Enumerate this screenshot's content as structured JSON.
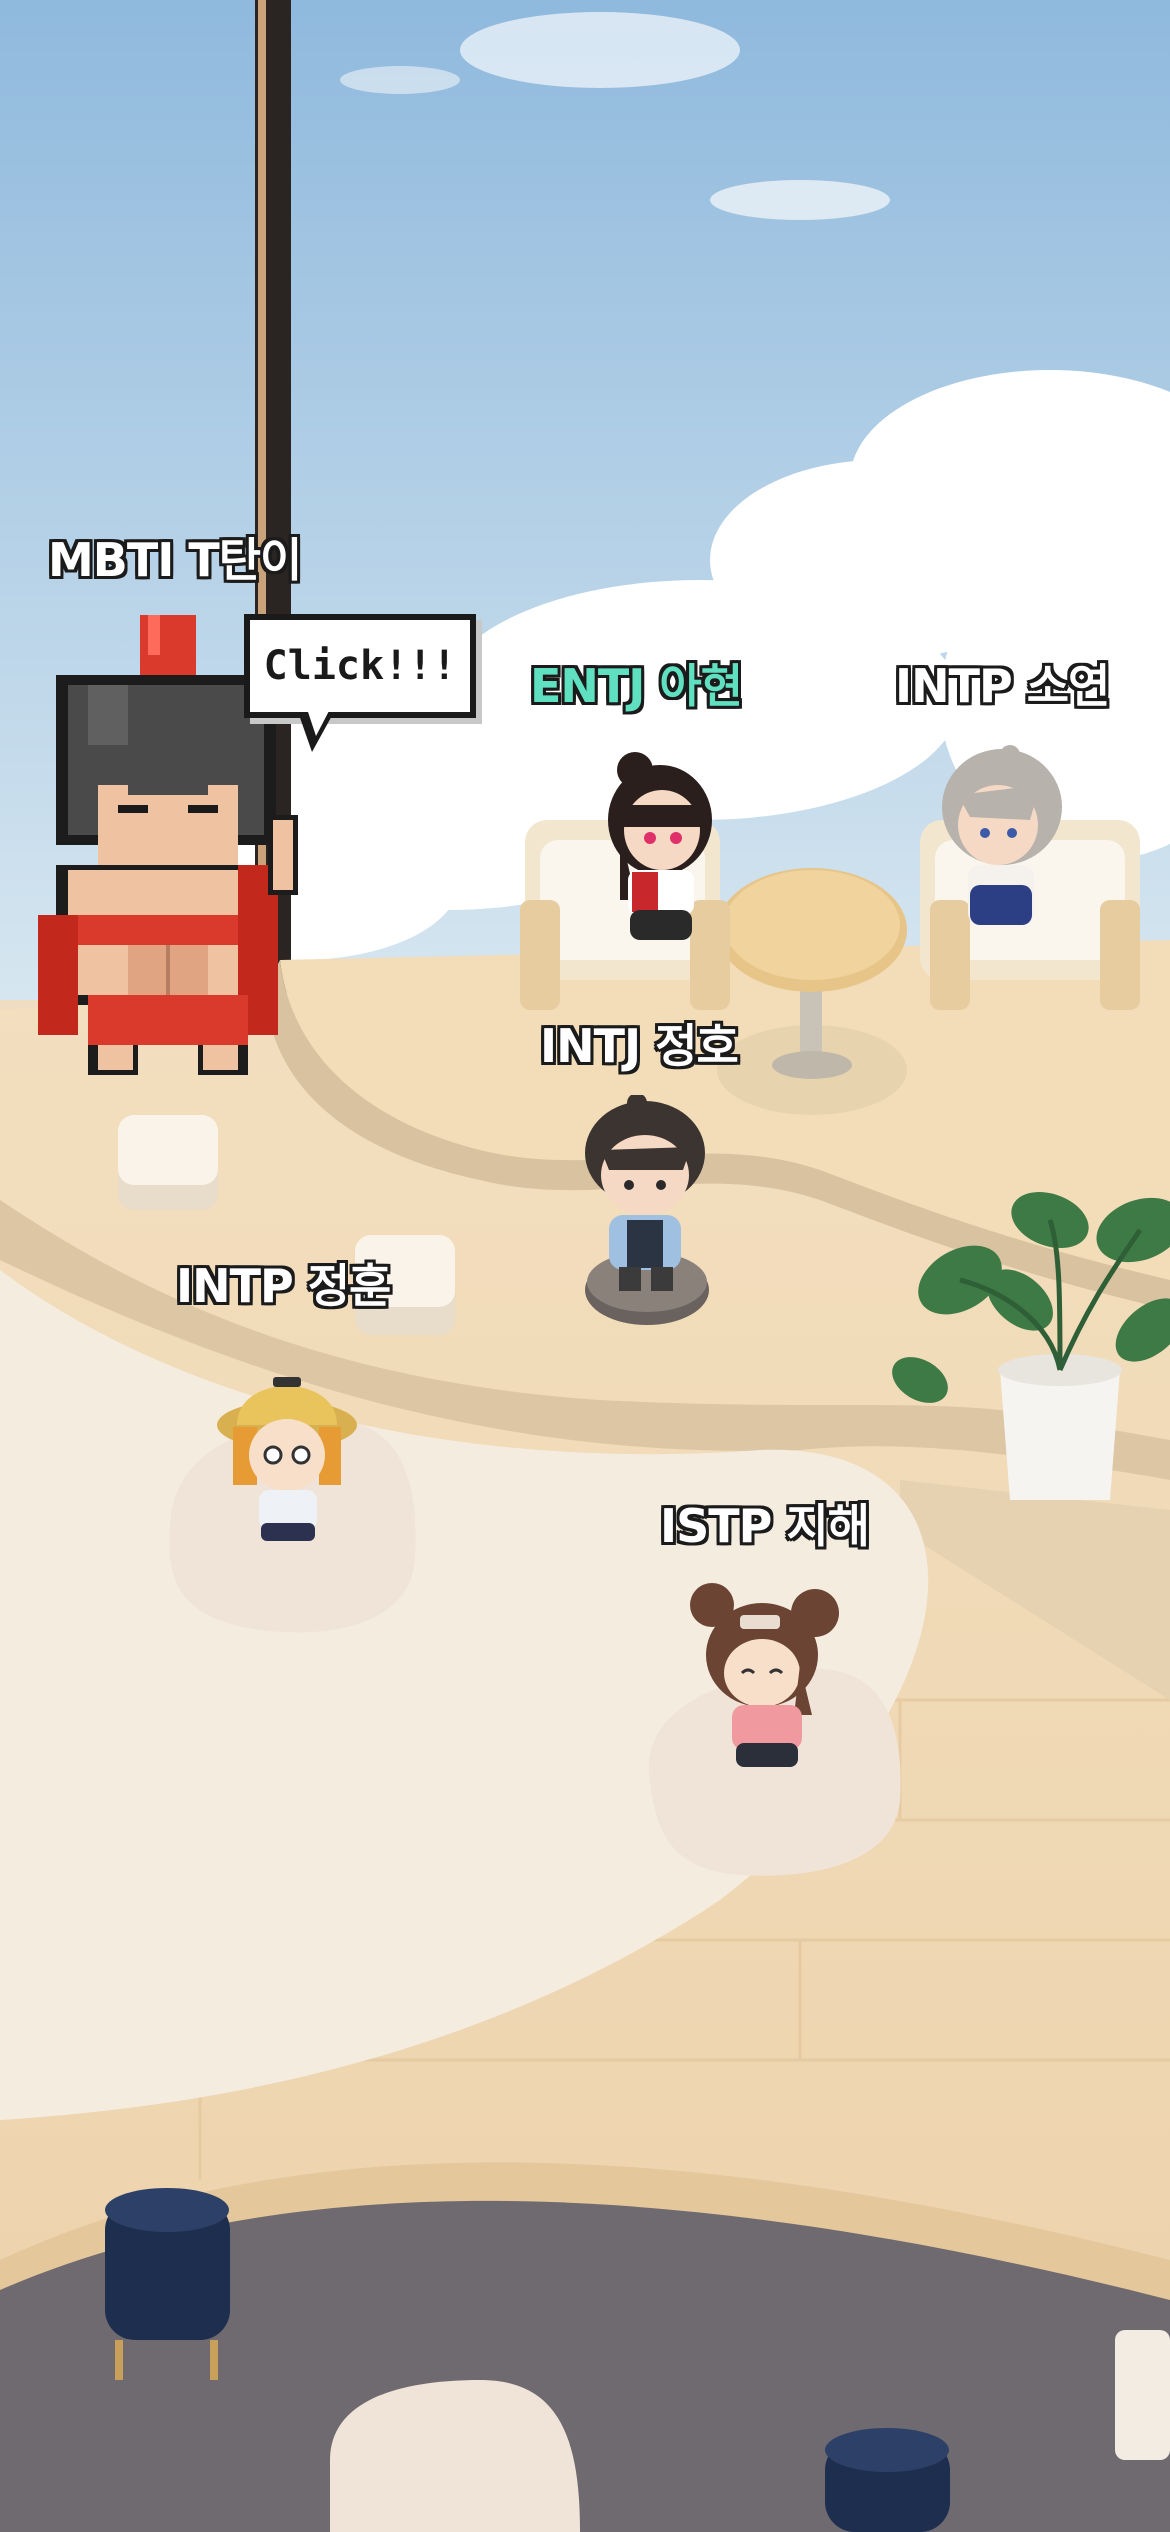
{
  "scene": {
    "colors": {
      "sky_top": "#9cc3e2",
      "sky_bottom": "#cfe2ef",
      "floor": "#f0d8b4",
      "rug": "#f4eadc",
      "dark_rug": "#6f6a70",
      "accent_name": "#5fe0c0"
    }
  },
  "mascot": {
    "name": "MBTI T탄이",
    "bubble_text": "Click!!!",
    "icon": "spartan-warrior-icon"
  },
  "characters": [
    {
      "name": "ENTJ 아현",
      "icon": "girl-dark-hair-icon"
    },
    {
      "name": "INTP 소연",
      "icon": "boy-gray-hair-icon"
    },
    {
      "name": "INTJ 정호",
      "icon": "boy-dark-hair-icon"
    },
    {
      "name": "INTP 정훈",
      "icon": "girl-bucket-hat-icon"
    },
    {
      "name": "ISTP 지해",
      "icon": "girl-buns-icon"
    }
  ]
}
